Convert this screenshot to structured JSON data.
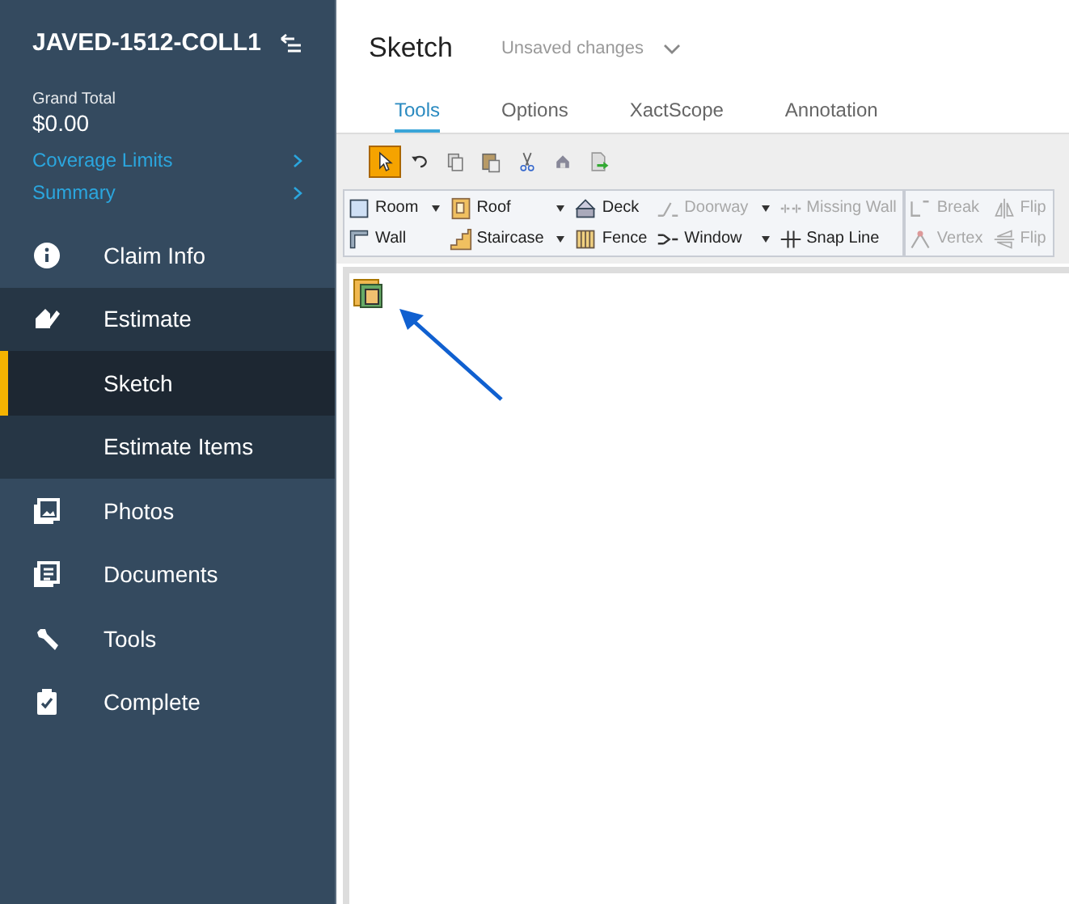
{
  "sidebar": {
    "title": "JAVED-1512-COLL1",
    "grand_total_label": "Grand Total",
    "grand_total": "$0.00",
    "links": [
      {
        "label": "Coverage Limits"
      },
      {
        "label": "Summary"
      }
    ],
    "nav": [
      {
        "label": "Claim Info",
        "kind": "item",
        "selected": false
      },
      {
        "label": "Estimate",
        "kind": "item",
        "selected": false,
        "expanded": true
      },
      {
        "label": "Sketch",
        "kind": "sub",
        "selected": true
      },
      {
        "label": "Estimate Items",
        "kind": "sub",
        "selected": false
      },
      {
        "label": "Photos",
        "kind": "item",
        "selected": false
      },
      {
        "label": "Documents",
        "kind": "item",
        "selected": false
      },
      {
        "label": "Tools",
        "kind": "item",
        "selected": false
      },
      {
        "label": "Complete",
        "kind": "item",
        "selected": false
      }
    ]
  },
  "header": {
    "title": "Sketch",
    "status": "Unsaved changes"
  },
  "tabs": [
    {
      "label": "Tools",
      "selected": true
    },
    {
      "label": "Options",
      "selected": false
    },
    {
      "label": "XactScope",
      "selected": false
    },
    {
      "label": "Annotation",
      "selected": false
    }
  ],
  "quick_tools": [
    {
      "selected": true
    },
    {
      "selected": false
    },
    {
      "selected": false
    },
    {
      "selected": false
    },
    {
      "selected": false
    },
    {
      "selected": false
    },
    {
      "selected": false
    }
  ],
  "ribbon": [
    {
      "columns": [
        {
          "buttons": [
            {
              "label": "Room",
              "dropdown": true,
              "disabled": false
            },
            {
              "label": "Wall",
              "dropdown": false,
              "disabled": false
            }
          ]
        },
        {
          "buttons": [
            {
              "label": "Roof",
              "dropdown": true,
              "disabled": false
            },
            {
              "label": "Staircase",
              "dropdown": true,
              "disabled": false
            }
          ]
        },
        {
          "buttons": [
            {
              "label": "Deck",
              "dropdown": false,
              "disabled": false
            },
            {
              "label": "Fence",
              "dropdown": false,
              "disabled": false
            }
          ]
        },
        {
          "buttons": [
            {
              "label": "Doorway",
              "dropdown": true,
              "disabled": true
            },
            {
              "label": "Window",
              "dropdown": true,
              "disabled": false
            }
          ]
        },
        {
          "buttons": [
            {
              "label": "Missing Wall",
              "dropdown": false,
              "disabled": true
            },
            {
              "label": "Snap Line",
              "dropdown": false,
              "disabled": false
            }
          ]
        }
      ]
    },
    {
      "columns": [
        {
          "buttons": [
            {
              "label": "Break",
              "dropdown": false,
              "disabled": true
            },
            {
              "label": "Vertex",
              "dropdown": false,
              "disabled": true
            }
          ]
        },
        {
          "buttons": [
            {
              "label": "Flip",
              "dropdown": false,
              "disabled": true
            },
            {
              "label": "Flip",
              "dropdown": false,
              "disabled": true
            }
          ]
        }
      ]
    }
  ]
}
